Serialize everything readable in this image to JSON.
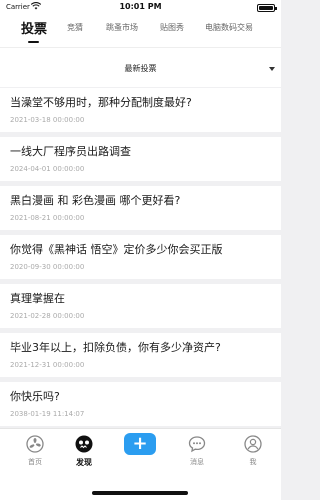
{
  "status": {
    "carrier": "Carrier",
    "time": "10:01 PM"
  },
  "tabs": [
    {
      "label": "投票"
    },
    {
      "label": "竞猜"
    },
    {
      "label": "跳蚤市场"
    },
    {
      "label": "贴图秀"
    },
    {
      "label": "电脑数码交易"
    }
  ],
  "filter": {
    "label": "最新投票"
  },
  "items": [
    {
      "title": "当澡堂不够用时，那种分配制度最好?",
      "date": "2021-03-18 00:00:00"
    },
    {
      "title": "一线大厂程序员出路调查",
      "date": "2024-04-01 00:00:00"
    },
    {
      "title": "黑白漫画 和 彩色漫画 哪个更好看?",
      "date": "2021-08-21 00:00:00"
    },
    {
      "title": "你觉得《黑神话 悟空》定价多少你会买正版",
      "date": "2020-09-30 00:00:00"
    },
    {
      "title": "真理掌握在",
      "date": "2021-02-28 00:00:00"
    },
    {
      "title": "毕业3年以上，扣除负债，你有多少净资产?",
      "date": "2021-12-31 00:00:00"
    },
    {
      "title": "你快乐吗?",
      "date": "2038-01-19 11:14:07"
    }
  ],
  "nav": {
    "home": "首页",
    "discover": "发现",
    "add": "+",
    "messages": "消息",
    "me": "我"
  },
  "colors": {
    "accent": "#2b9df0",
    "background": "#f0f0f2"
  }
}
